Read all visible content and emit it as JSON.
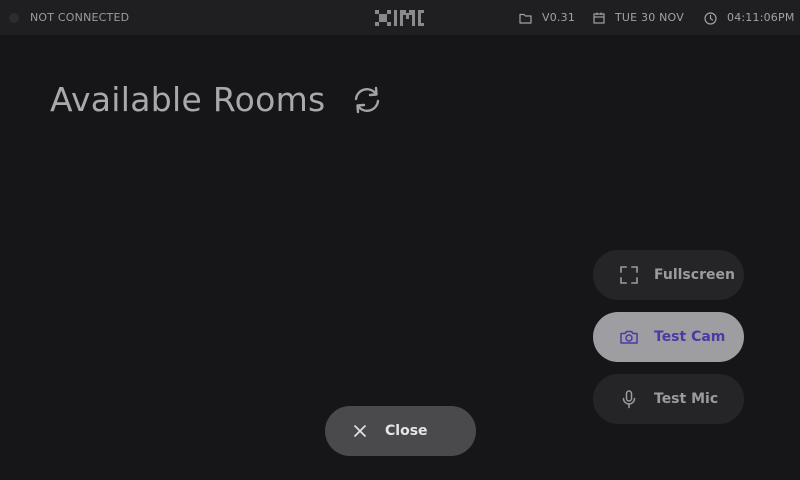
{
  "topbar": {
    "connection_status": "NOT CONNECTED",
    "logo_text": "XIMI",
    "version": "V0.31",
    "date": "TUE 30 NOV",
    "time": "04:11:06PM",
    "icons": {
      "status": "status-dot-icon",
      "version": "folder-icon",
      "date": "calendar-icon",
      "time": "clock-icon"
    }
  },
  "main": {
    "title": "Available Rooms",
    "refresh_icon": "refresh-icon"
  },
  "side_buttons": [
    {
      "label": "Fullscreen",
      "icon": "fullscreen-icon",
      "active": false
    },
    {
      "label": "Test Cam",
      "icon": "camera-icon",
      "active": true
    },
    {
      "label": "Test Mic",
      "icon": "microphone-icon",
      "active": false
    }
  ],
  "close_button": {
    "label": "Close",
    "icon": "close-icon"
  },
  "colors": {
    "background": "#161618",
    "topbar": "#1f1f21",
    "button": "#252527",
    "button_active": "#9e9ea2",
    "accent": "#4b3aa3",
    "close_button": "#4a4a4d"
  }
}
